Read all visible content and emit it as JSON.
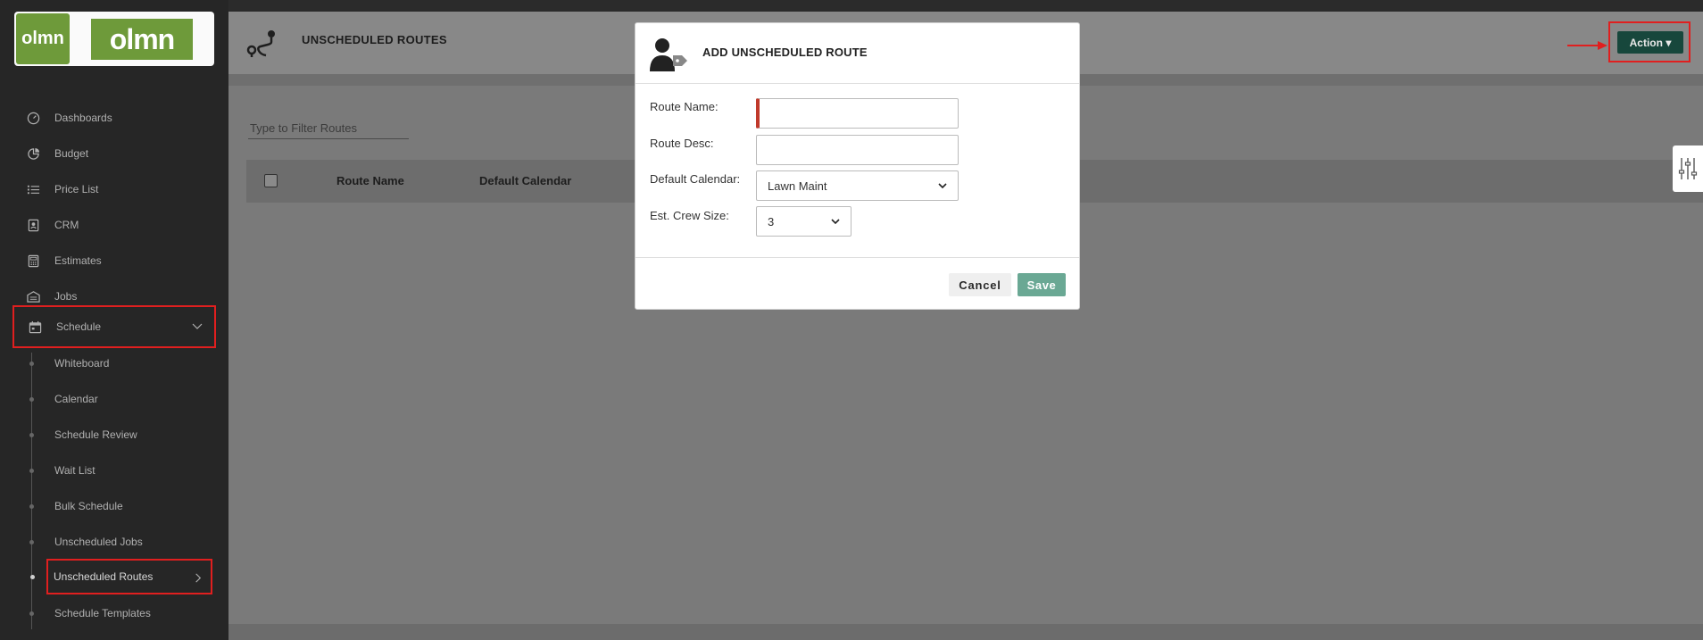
{
  "brand": {
    "logo_small": "olmn",
    "logo_big": "olmn"
  },
  "sidebar": {
    "items": [
      {
        "label": "Dashboards",
        "icon": "dashboard-icon"
      },
      {
        "label": "Budget",
        "icon": "pie-chart-icon"
      },
      {
        "label": "Price List",
        "icon": "list-icon"
      },
      {
        "label": "CRM",
        "icon": "contact-icon"
      },
      {
        "label": "Estimates",
        "icon": "calculator-icon"
      },
      {
        "label": "Jobs",
        "icon": "jobs-icon"
      },
      {
        "label": "Schedule",
        "icon": "calendar-icon",
        "expanded": true
      }
    ],
    "schedule_subitems": [
      {
        "label": "Whiteboard"
      },
      {
        "label": "Calendar"
      },
      {
        "label": "Schedule Review"
      },
      {
        "label": "Wait List"
      },
      {
        "label": "Bulk Schedule"
      },
      {
        "label": "Unscheduled Jobs"
      },
      {
        "label": "Unscheduled Routes",
        "active": true
      },
      {
        "label": "Schedule Templates"
      }
    ]
  },
  "header": {
    "title": "UNSCHEDULED ROUTES",
    "action_label": "Action"
  },
  "filter": {
    "placeholder": "Type to Filter Routes"
  },
  "table": {
    "columns": [
      "Route Name",
      "Default Calendar"
    ]
  },
  "modal": {
    "title": "ADD UNSCHEDULED ROUTE",
    "fields": {
      "route_name_label": "Route Name:",
      "route_name_value": "",
      "route_desc_label": "Route Desc:",
      "route_desc_value": "",
      "default_calendar_label": "Default Calendar:",
      "default_calendar_value": "Lawn Maint",
      "crew_size_label": "Est. Crew Size:",
      "crew_size_value": "3"
    },
    "cancel_label": "Cancel",
    "save_label": "Save"
  },
  "colors": {
    "sidebar_bg": "#262626",
    "brand_green": "#6e9a3a",
    "action_bg": "#17473c",
    "save_bg": "#6aa894",
    "highlight_red": "#e01f1f"
  }
}
